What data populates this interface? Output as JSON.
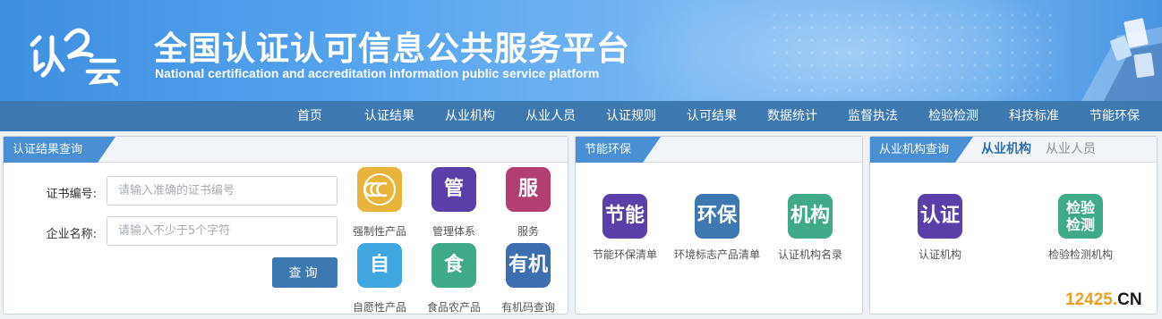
{
  "header": {
    "logo_text": "认云",
    "title": "全国认证认可信息公共服务平台",
    "subtitle": "National certification and accreditation information public service platform"
  },
  "nav": {
    "items": [
      "首页",
      "认证结果",
      "从业机构",
      "从业人员",
      "认证规则",
      "认可结果",
      "数据统计",
      "监督执法",
      "检验检测",
      "科技标准",
      "节能环保"
    ]
  },
  "panel_cert": {
    "tab": "认证结果查询",
    "cert_no_label": "证书编号:",
    "cert_no_placeholder": "请输入准确的证书编号",
    "company_label": "企业名称:",
    "company_placeholder": "请输入不少于5个字符",
    "query_button": "查询",
    "tiles": [
      {
        "icon": "ccc-mark-icon",
        "glyph": "CCC",
        "label": "强制性产品",
        "color": "#e8b43a"
      },
      {
        "icon": "management-icon",
        "glyph": "管",
        "label": "管理体系",
        "color": "#5b3fa8"
      },
      {
        "icon": "service-icon",
        "glyph": "服",
        "label": "服务",
        "color": "#b23f72"
      },
      {
        "icon": "voluntary-icon",
        "glyph": "自",
        "label": "自愿性产品",
        "color": "#3fa6e0"
      },
      {
        "icon": "food-icon",
        "glyph": "食",
        "label": "食品农产品",
        "color": "#3fa98a"
      },
      {
        "icon": "organic-icon",
        "glyph": "有机",
        "label": "有机码查询",
        "color": "#3d6fb0"
      }
    ]
  },
  "panel_energy": {
    "tab": "节能环保",
    "tiles": [
      {
        "icon": "energy-saving-icon",
        "glyph": "节能",
        "label": "节能环保清单",
        "color": "#5b3fa8"
      },
      {
        "icon": "environment-icon",
        "glyph": "环保",
        "label": "环境标志产品清单",
        "color": "#3d79b0"
      },
      {
        "icon": "institution-icon",
        "glyph": "机构",
        "label": "认证机构名录",
        "color": "#3fa98a"
      }
    ]
  },
  "panel_org": {
    "tab": "从业机构查询",
    "sub_tabs": [
      "从业机构",
      "从业人员"
    ],
    "active_sub_tab": "从业机构",
    "tiles": [
      {
        "icon": "certification-icon",
        "glyph": "认证",
        "label": "认证机构",
        "color": "#5b3fa8"
      },
      {
        "icon": "inspection-icon",
        "glyph": "检验检测",
        "label": "检验检测机构",
        "color": "#3fa98a"
      }
    ]
  },
  "watermark": {
    "num": "12425",
    "dot": ".",
    "cn": "CN"
  },
  "colors": {
    "nav_bg": "#3d79b0",
    "tab_bg": "#4a8ed4",
    "watermark_num": "#f0a020",
    "watermark_cn": "#1a1a1a"
  }
}
